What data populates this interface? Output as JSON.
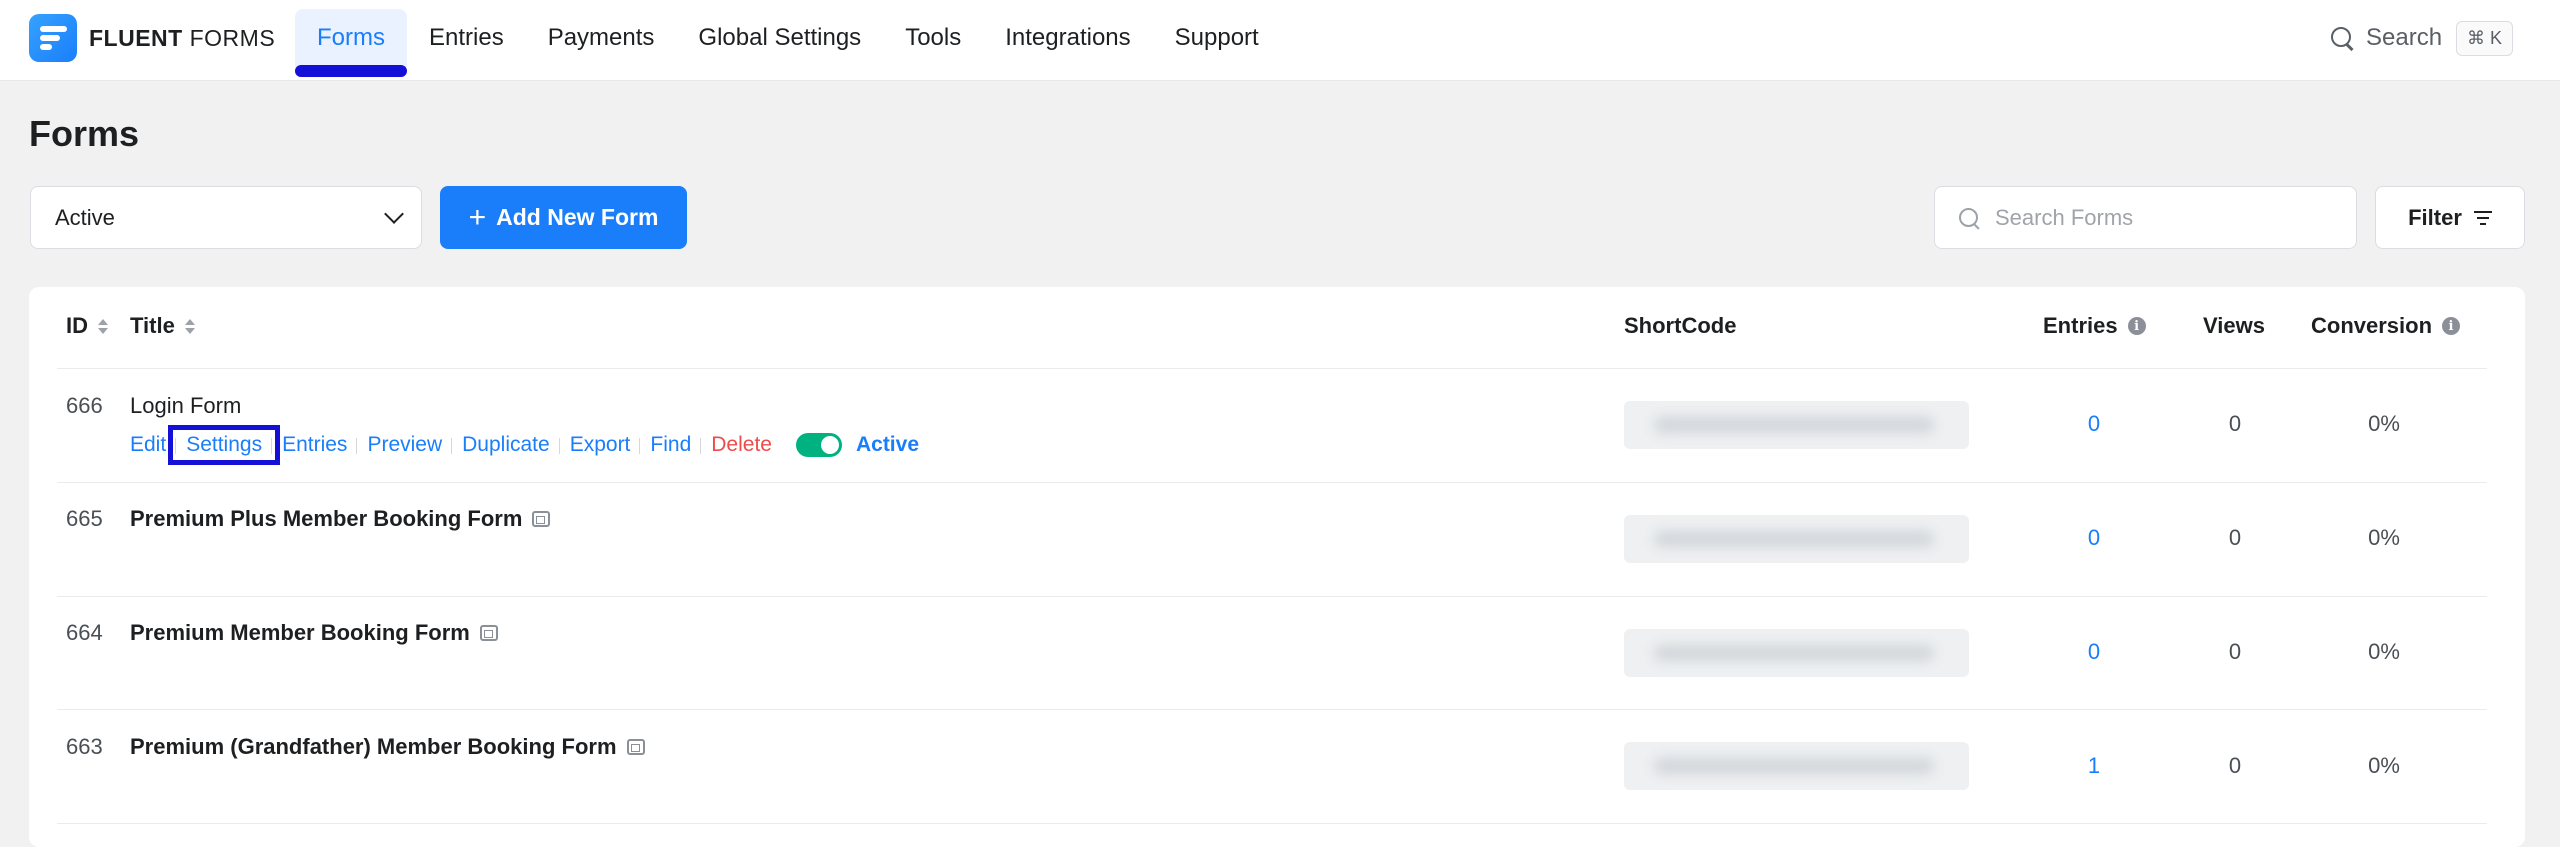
{
  "brand": {
    "name_bold": "FLUENT",
    "name_light": "FORMS"
  },
  "nav": [
    "Forms",
    "Entries",
    "Payments",
    "Global Settings",
    "Tools",
    "Integrations",
    "Support"
  ],
  "search_top": {
    "label": "Search",
    "shortcut": "⌘ K"
  },
  "page_title": "Forms",
  "status_select": {
    "value": "Active"
  },
  "add_button": {
    "label": "Add New Form"
  },
  "search_forms": {
    "placeholder": "Search Forms"
  },
  "filter_button": {
    "label": "Filter"
  },
  "table": {
    "headers": {
      "id": "ID",
      "title": "Title",
      "shortcode": "ShortCode",
      "entries": "Entries",
      "views": "Views",
      "conversion": "Conversion"
    },
    "rows": [
      {
        "id": "666",
        "title": "Login Form",
        "entries": "0",
        "views": "0",
        "conversion": "0%"
      },
      {
        "id": "665",
        "title": "Premium Plus Member Booking Form",
        "entries": "0",
        "views": "0",
        "conversion": "0%"
      },
      {
        "id": "664",
        "title": "Premium Member Booking Form",
        "entries": "0",
        "views": "0",
        "conversion": "0%"
      },
      {
        "id": "663",
        "title": "Premium (Grandfather) Member Booking Form",
        "entries": "1",
        "views": "0",
        "conversion": "0%"
      }
    ],
    "row_actions": [
      "Edit",
      "Settings",
      "Entries",
      "Preview",
      "Duplicate",
      "Export",
      "Find",
      "Delete"
    ],
    "status_label": "Active"
  },
  "colors": {
    "primary": "#1a7efb",
    "highlight": "#1510d8",
    "danger": "#ef4b4b",
    "toggle_on": "#00b27f"
  },
  "icons": {
    "search": "search-icon",
    "chevron": "chevron-down-icon",
    "plus": "plus-icon",
    "filter": "filter-icon",
    "info": "info-icon",
    "doc": "document-icon"
  }
}
